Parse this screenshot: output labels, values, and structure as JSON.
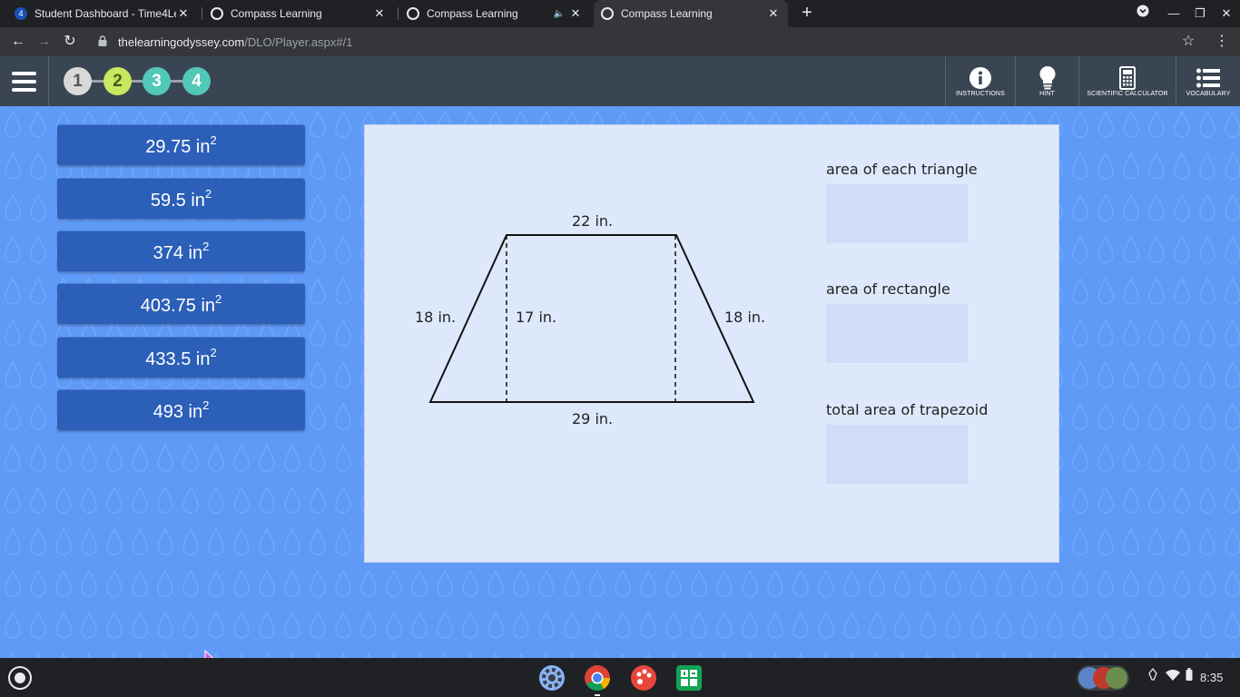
{
  "browser": {
    "tabs": [
      {
        "title": "Student Dashboard - Time4Learning",
        "active": false
      },
      {
        "title": "Compass Learning",
        "active": false
      },
      {
        "title": "Compass Learning",
        "active": false
      },
      {
        "title": "Compass Learning",
        "active": true
      }
    ],
    "url_host": "thelearningodyssey.com",
    "url_path": "/DLO/Player.aspx#/1"
  },
  "header": {
    "steps": [
      {
        "label": "1",
        "color": "#d9d9d9"
      },
      {
        "label": "2",
        "color": "#c6e95f"
      },
      {
        "label": "3",
        "color": "#52c9b8"
      },
      {
        "label": "4",
        "color": "#52c9b8"
      }
    ],
    "tools": [
      {
        "label": "Instructions",
        "icon": "info-icon"
      },
      {
        "label": "Hint",
        "icon": "lightbulb-icon"
      },
      {
        "label": "Scientific Calculator",
        "icon": "calculator-icon"
      },
      {
        "label": "Vocabulary",
        "icon": "list-icon"
      }
    ]
  },
  "choices": [
    {
      "value": "29.75 in",
      "exp": "2"
    },
    {
      "value": "59.5 in",
      "exp": "2"
    },
    {
      "value": "374 in",
      "exp": "2"
    },
    {
      "value": "403.75 in",
      "exp": "2"
    },
    {
      "value": "433.5 in",
      "exp": "2"
    },
    {
      "value": "493 in",
      "exp": "2"
    }
  ],
  "diagram": {
    "top": "22 in.",
    "bottom": "29 in.",
    "left_side": "18 in.",
    "right_side": "18 in.",
    "height": "17 in."
  },
  "answers": [
    {
      "label": "area of each triangle"
    },
    {
      "label": "area of rectangle"
    },
    {
      "label": "total area of trapezoid"
    }
  ],
  "taskbar": {
    "apps": [
      "settings-icon",
      "chrome-icon",
      "paint-icon",
      "sheets-icon"
    ],
    "clock": "8:35"
  },
  "colors": {
    "page_bg": "#5f9af7",
    "choice_bg": "#2b5fb8",
    "panel_bg": "#dde8fb",
    "header_bg": "#3a4553"
  }
}
